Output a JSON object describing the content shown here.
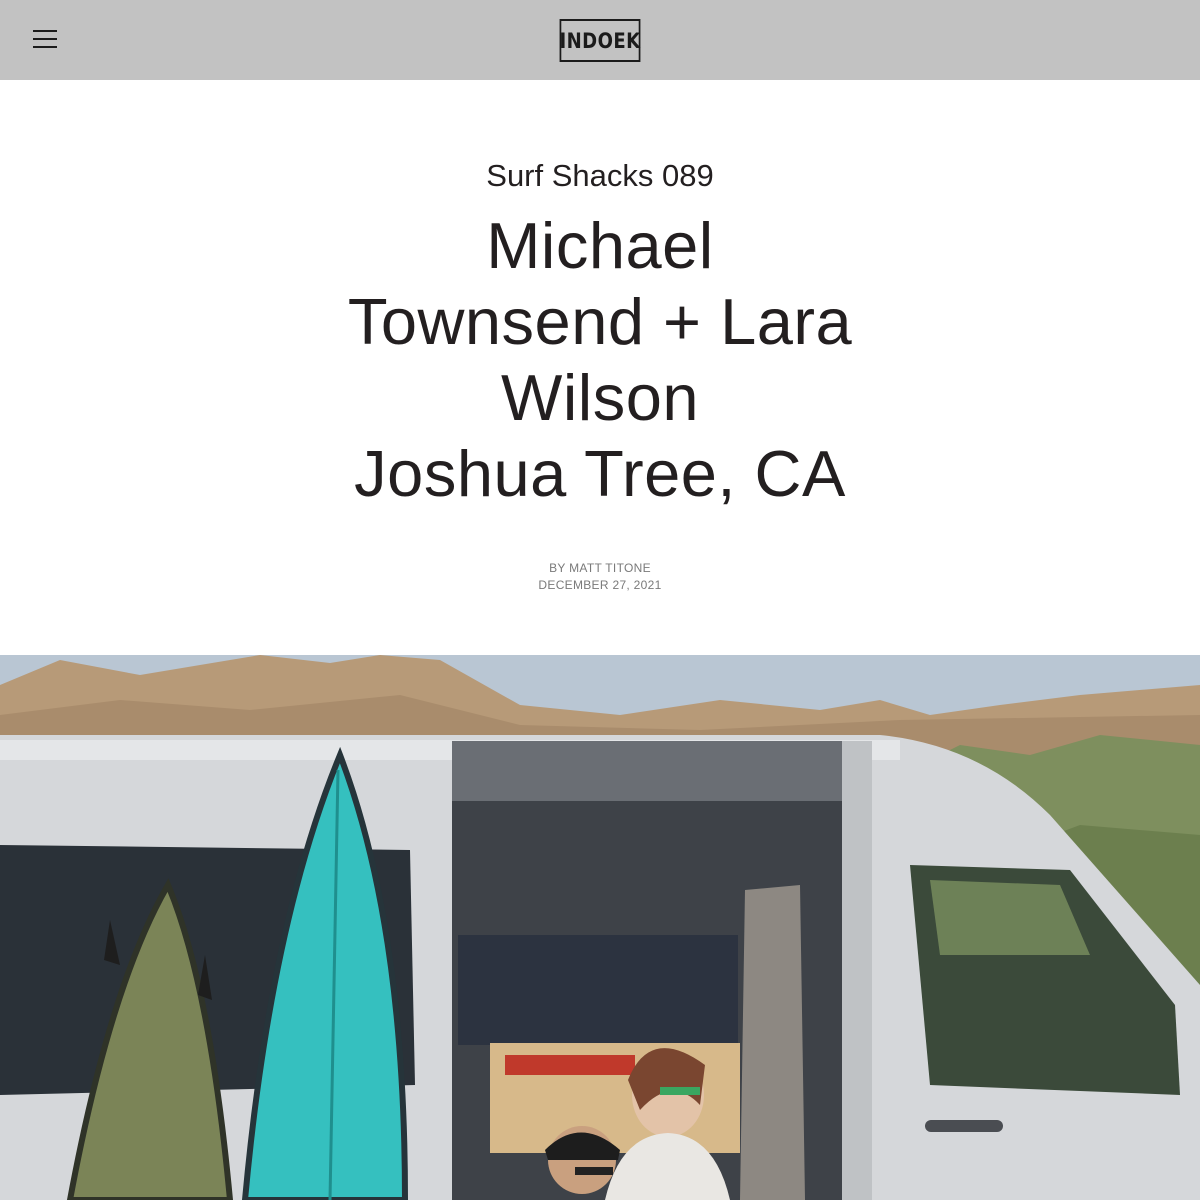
{
  "header": {
    "menu_icon": "hamburger-menu-icon",
    "logo_text": "INDOEK"
  },
  "article": {
    "kicker": "Surf Shacks 089",
    "title_lines": [
      "Michael",
      "Townsend + Lara",
      "Wilson",
      "Joshua Tree, CA"
    ],
    "byline": "BY MATT TITONE",
    "date": "DECEMBER 27, 2021"
  },
  "hero_image": {
    "subject": "hero-photo"
  },
  "colors": {
    "header_bg": "#c2c2c2",
    "text": "#231f20",
    "meta_text": "#7a7a7a"
  }
}
